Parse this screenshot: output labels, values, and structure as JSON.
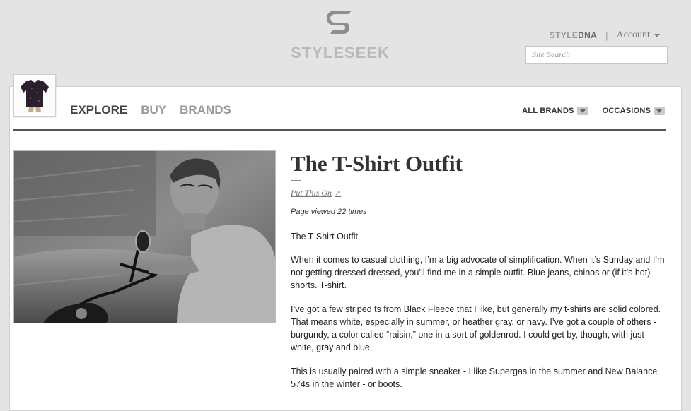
{
  "brand": {
    "name": "STYLESEEK"
  },
  "topnav": {
    "styledna_prefix": "STYLE",
    "styledna_suffix": "DNA",
    "separator": "|",
    "account_label": "Account"
  },
  "search": {
    "placeholder": "Site Search"
  },
  "mainnav": {
    "explore": "EXPLORE",
    "buy": "BUY",
    "brands": "BRANDS"
  },
  "filters": {
    "all_brands": "ALL BRANDS",
    "occasions": "OCCASIONS"
  },
  "article": {
    "title": "The T-Shirt Outfit",
    "source_link": "Put This On",
    "views": "Page viewed 22 times",
    "paragraphs": [
      "The T-Shirt Outfit",
      "When it comes to casual clothing, I’m a big advocate of simplification. When it’s Sunday and I’m not getting dressed dressed, you’ll find me in a simple outfit. Blue jeans, chinos or (if it’s hot) shorts. T-shirt.",
      "I’ve got a few striped ts from Black Fleece that I like, but generally my t-shirts are solid colored. That means white, especially in summer, or heather gray, or navy. I’ve got a couple of others - burgundy, a color called “raisin,” one in a sort of goldenrod. I could get by, though, with just white, gray and blue.",
      "This is usually paired with a simple sneaker - I like Supergas in the summer and New Balance 574s in the winter - or boots."
    ]
  },
  "colors": {
    "page_bg": "#e4e4e4",
    "accent_rule": "#555555",
    "logo_gray": "#b9b9b9"
  }
}
